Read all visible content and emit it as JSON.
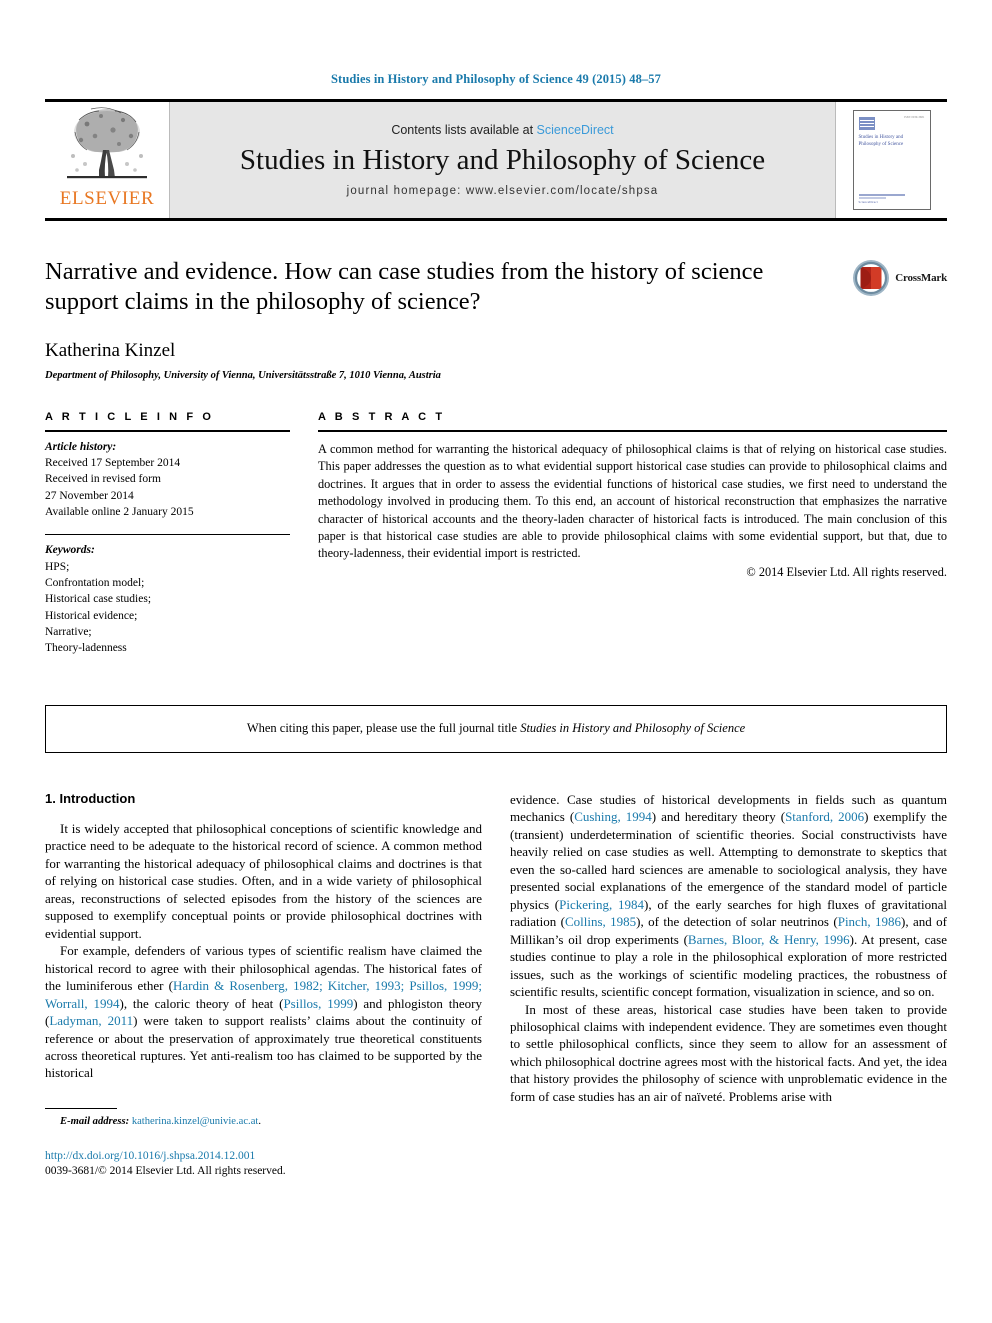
{
  "running_head": "Studies in History and Philosophy of Science 49 (2015) 48–57",
  "masthead": {
    "publisher_logo_label": "ELSEVIER",
    "contents_prefix": "Contents lists available at ",
    "contents_link": "ScienceDirect",
    "journal_title": "Studies in History and Philosophy of Science",
    "homepage_line": "journal homepage: www.elsevier.com/locate/shpsa",
    "cover": {
      "title": "Studies in History and Philosophy of Science",
      "top_right": "ISSN 0039-3681",
      "foot_text": "ScienceDirect"
    }
  },
  "article": {
    "title": "Narrative and evidence. How can case studies from the history of science support claims in the philosophy of science?",
    "author": "Katherina Kinzel",
    "affiliation": "Department of Philosophy, University of Vienna, Universitätsstraße 7, 1010 Vienna, Austria",
    "crossmark_label": "CrossMark"
  },
  "article_info": {
    "heading": "A R T I C L E   I N F O",
    "history_label": "Article history:",
    "history": [
      "Received 17 September 2014",
      "Received in revised form",
      "27 November 2014",
      "Available online 2 January 2015"
    ],
    "keywords_label": "Keywords:",
    "keywords": [
      "HPS;",
      "Confrontation model;",
      "Historical case studies;",
      "Historical evidence;",
      "Narrative;",
      "Theory-ladenness"
    ]
  },
  "abstract": {
    "heading": "A B S T R A C T",
    "text": "A common method for warranting the historical adequacy of philosophical claims is that of relying on historical case studies. This paper addresses the question as to what evidential support historical case studies can provide to philosophical claims and doctrines. It argues that in order to assess the evidential functions of historical case studies, we first need to understand the methodology involved in producing them. To this end, an account of historical reconstruction that emphasizes the narrative character of historical accounts and the theory-laden character of historical facts is introduced. The main conclusion of this paper is that historical case studies are able to provide philosophical claims with some evidential support, but that, due to theory-ladenness, their evidential import is restricted.",
    "copyright": "© 2014 Elsevier Ltd. All rights reserved."
  },
  "citation_note": {
    "prefix": "When citing this paper, please use the full journal title ",
    "journal": "Studies in History and Philosophy of Science"
  },
  "body": {
    "section_title": "1. Introduction",
    "left_p1": "It is widely accepted that philosophical conceptions of scientific knowledge and practice need to be adequate to the historical record of science. A common method for warranting the historical adequacy of philosophical claims and doctrines is that of relying on historical case studies. Often, and in a wide variety of philosophical areas, reconstructions of selected episodes from the history of the sciences are supposed to exemplify conceptual points or provide philosophical doctrines with evidential support.",
    "left_p2_segments": [
      {
        "t": "For example, defenders of various types of scientific realism have claimed the historical record to agree with their philosophical agendas. The historical fates of the luminiferous ether (",
        "link": false
      },
      {
        "t": "Hardin & Rosenberg, 1982; Kitcher, 1993; Psillos, 1999; Worrall, 1994",
        "link": true
      },
      {
        "t": "), the caloric theory of heat (",
        "link": false
      },
      {
        "t": "Psillos, 1999",
        "link": true
      },
      {
        "t": ") and phlogiston theory (",
        "link": false
      },
      {
        "t": "Ladyman, 2011",
        "link": true
      },
      {
        "t": ") were taken to support realists’ claims about the continuity of reference or about the preservation of approximately true theoretical constituents across theoretical ruptures. Yet anti-realism too has claimed to be supported by the historical",
        "link": false
      }
    ],
    "right_p1_segments": [
      {
        "t": "evidence. Case studies of historical developments in fields such as quantum mechanics (",
        "link": false
      },
      {
        "t": "Cushing, 1994",
        "link": true
      },
      {
        "t": ") and hereditary theory (",
        "link": false
      },
      {
        "t": "Stanford, 2006",
        "link": true
      },
      {
        "t": ") exemplify the (transient) underdetermination of scientific theories. Social constructivists have heavily relied on case studies as well. Attempting to demonstrate to skeptics that even the so-called hard sciences are amenable to sociological analysis, they have presented social explanations of the emergence of the standard model of particle physics (",
        "link": false
      },
      {
        "t": "Pickering, 1984",
        "link": true
      },
      {
        "t": "), of the early searches for high fluxes of gravitational radiation (",
        "link": false
      },
      {
        "t": "Collins, 1985",
        "link": true
      },
      {
        "t": "), of the detection of solar neutrinos (",
        "link": false
      },
      {
        "t": "Pinch, 1986",
        "link": true
      },
      {
        "t": "), and of Millikan’s oil drop experiments (",
        "link": false
      },
      {
        "t": "Barnes, Bloor, & Henry, 1996",
        "link": true
      },
      {
        "t": "). At present, case studies continue to play a role in the philosophical exploration of more restricted issues, such as the workings of scientific modeling practices, the robustness of scientific results, scientific concept formation, visualization in science, and so on.",
        "link": false
      }
    ],
    "right_p2": "In most of these areas, historical case studies have been taken to provide philosophical claims with independent evidence. They are sometimes even thought to settle philosophical conflicts, since they seem to allow for an assessment of which philosophical doctrine agrees most with the historical facts. And yet, the idea that history provides the philosophy of science with unproblematic evidence in the form of case studies has an air of naïveté. Problems arise with"
  },
  "footnote": {
    "label": "E-mail address:",
    "email": "katherina.kinzel@univie.ac.at",
    "trailing": "."
  },
  "footer": {
    "doi": "http://dx.doi.org/10.1016/j.shpsa.2014.12.001",
    "issn_line": "0039-3681/© 2014 Elsevier Ltd. All rights reserved."
  },
  "colors": {
    "link_blue": "#1a7aab",
    "sciencedirect_blue": "#3a9ad9",
    "elsevier_orange": "#E87722",
    "band_gray": "#e6e6e6"
  }
}
